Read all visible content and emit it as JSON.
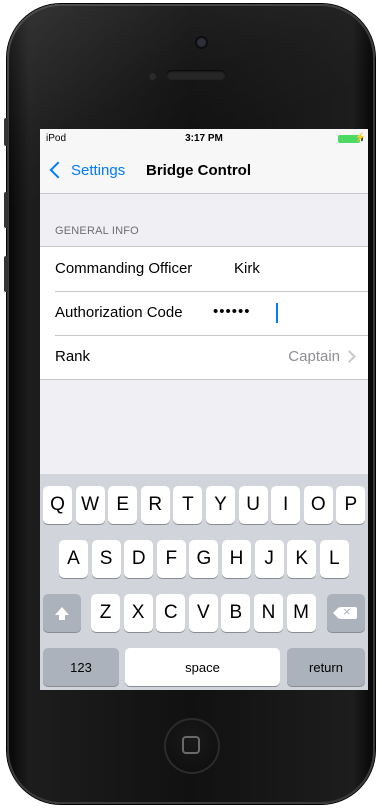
{
  "status_bar": {
    "carrier": "iPod",
    "time": "3:17 PM",
    "charging_symbol": "⚡"
  },
  "navbar": {
    "back_label": "Settings",
    "title": "Bridge Control"
  },
  "section": {
    "header": "GENERAL INFO",
    "rows": [
      {
        "label": "Commanding Officer",
        "value": "Kirk"
      },
      {
        "label": "Authorization Code",
        "value": "••••••"
      },
      {
        "label": "Rank",
        "value": "Captain"
      }
    ]
  },
  "keyboard": {
    "row1": [
      "Q",
      "W",
      "E",
      "R",
      "T",
      "Y",
      "U",
      "I",
      "O",
      "P"
    ],
    "row2": [
      "A",
      "S",
      "D",
      "F",
      "G",
      "H",
      "J",
      "K",
      "L"
    ],
    "row3": [
      "Z",
      "X",
      "C",
      "V",
      "B",
      "N",
      "M"
    ],
    "numbers_label": "123",
    "space_label": "space",
    "return_label": "return"
  },
  "colors": {
    "accent": "#007aff",
    "battery": "#4cd964",
    "background": "#efeff4"
  },
  "icons": {
    "back": "chevron-left-icon",
    "disclosure": "chevron-right-icon",
    "shift": "shift-icon",
    "delete": "backspace-icon"
  }
}
